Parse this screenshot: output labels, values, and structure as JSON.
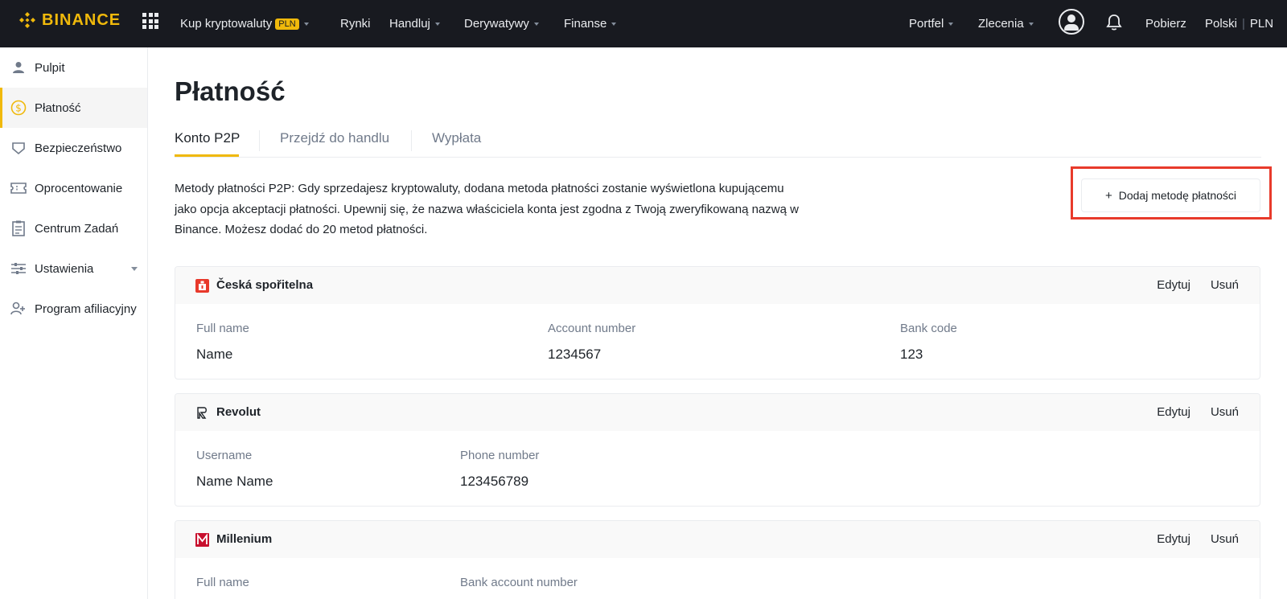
{
  "brand": {
    "name": "BINANCE",
    "accent": "#f0b90b"
  },
  "nav": {
    "buy_crypto": "Kup kryptowaluty",
    "buy_badge": "PLN",
    "markets": "Rynki",
    "trade": "Handluj",
    "derivatives": "Derywatywy",
    "finance": "Finanse",
    "wallet": "Portfel",
    "orders": "Zlecenia",
    "download": "Pobierz",
    "language": "Polski",
    "currency": "PLN"
  },
  "sidebar": {
    "items": [
      {
        "label": "Pulpit",
        "icon": "user-icon"
      },
      {
        "label": "Płatność",
        "icon": "dollar-icon",
        "active": true
      },
      {
        "label": "Bezpieczeństwo",
        "icon": "shield-icon"
      },
      {
        "label": "Oprocentowanie",
        "icon": "ticket-icon"
      },
      {
        "label": "Centrum Zadań",
        "icon": "task-list-icon"
      },
      {
        "label": "Ustawienia",
        "icon": "sliders-icon"
      },
      {
        "label": "Program afiliacyjny",
        "icon": "add-user-icon"
      }
    ]
  },
  "main": {
    "title": "Płatność",
    "tabs": [
      {
        "label": "Konto P2P",
        "active": true
      },
      {
        "label": "Przejdź do handlu"
      },
      {
        "label": "Wypłata"
      }
    ],
    "description": {
      "line1": "Metody płatności P2P: Gdy sprzedajesz kryptowaluty, dodana metoda płatności zostanie wyświetlona kupującemu",
      "line2": "jako opcja akceptacji płatności. Upewnij się, że nazwa właściciela konta jest zgodna z Twoją zweryfikowaną nazwą w",
      "line3": "Binance. Możesz dodać do 20 metod płatności."
    },
    "add_button": {
      "plus": "+",
      "label": "Dodaj metodę płatności"
    },
    "edit_label": "Edytuj",
    "delete_label": "Usuń",
    "cards": [
      {
        "name": "Česká spořitelna",
        "icon": "ceska-sporitelna-logo-icon",
        "fields": [
          {
            "label": "Full name",
            "value": "Name"
          },
          {
            "label": "Account number",
            "value": "1234567"
          },
          {
            "label": "Bank code",
            "value": "123"
          }
        ]
      },
      {
        "name": "Revolut",
        "icon": "revolut-logo-icon",
        "fields": [
          {
            "label": "Username",
            "value": "Name Name"
          },
          {
            "label": "Phone number",
            "value": "123456789"
          }
        ]
      },
      {
        "name": "Millenium",
        "icon": "millenium-logo-icon",
        "fields": [
          {
            "label": "Full name",
            "value": ""
          },
          {
            "label": "Bank account number",
            "value": ""
          }
        ]
      }
    ]
  }
}
